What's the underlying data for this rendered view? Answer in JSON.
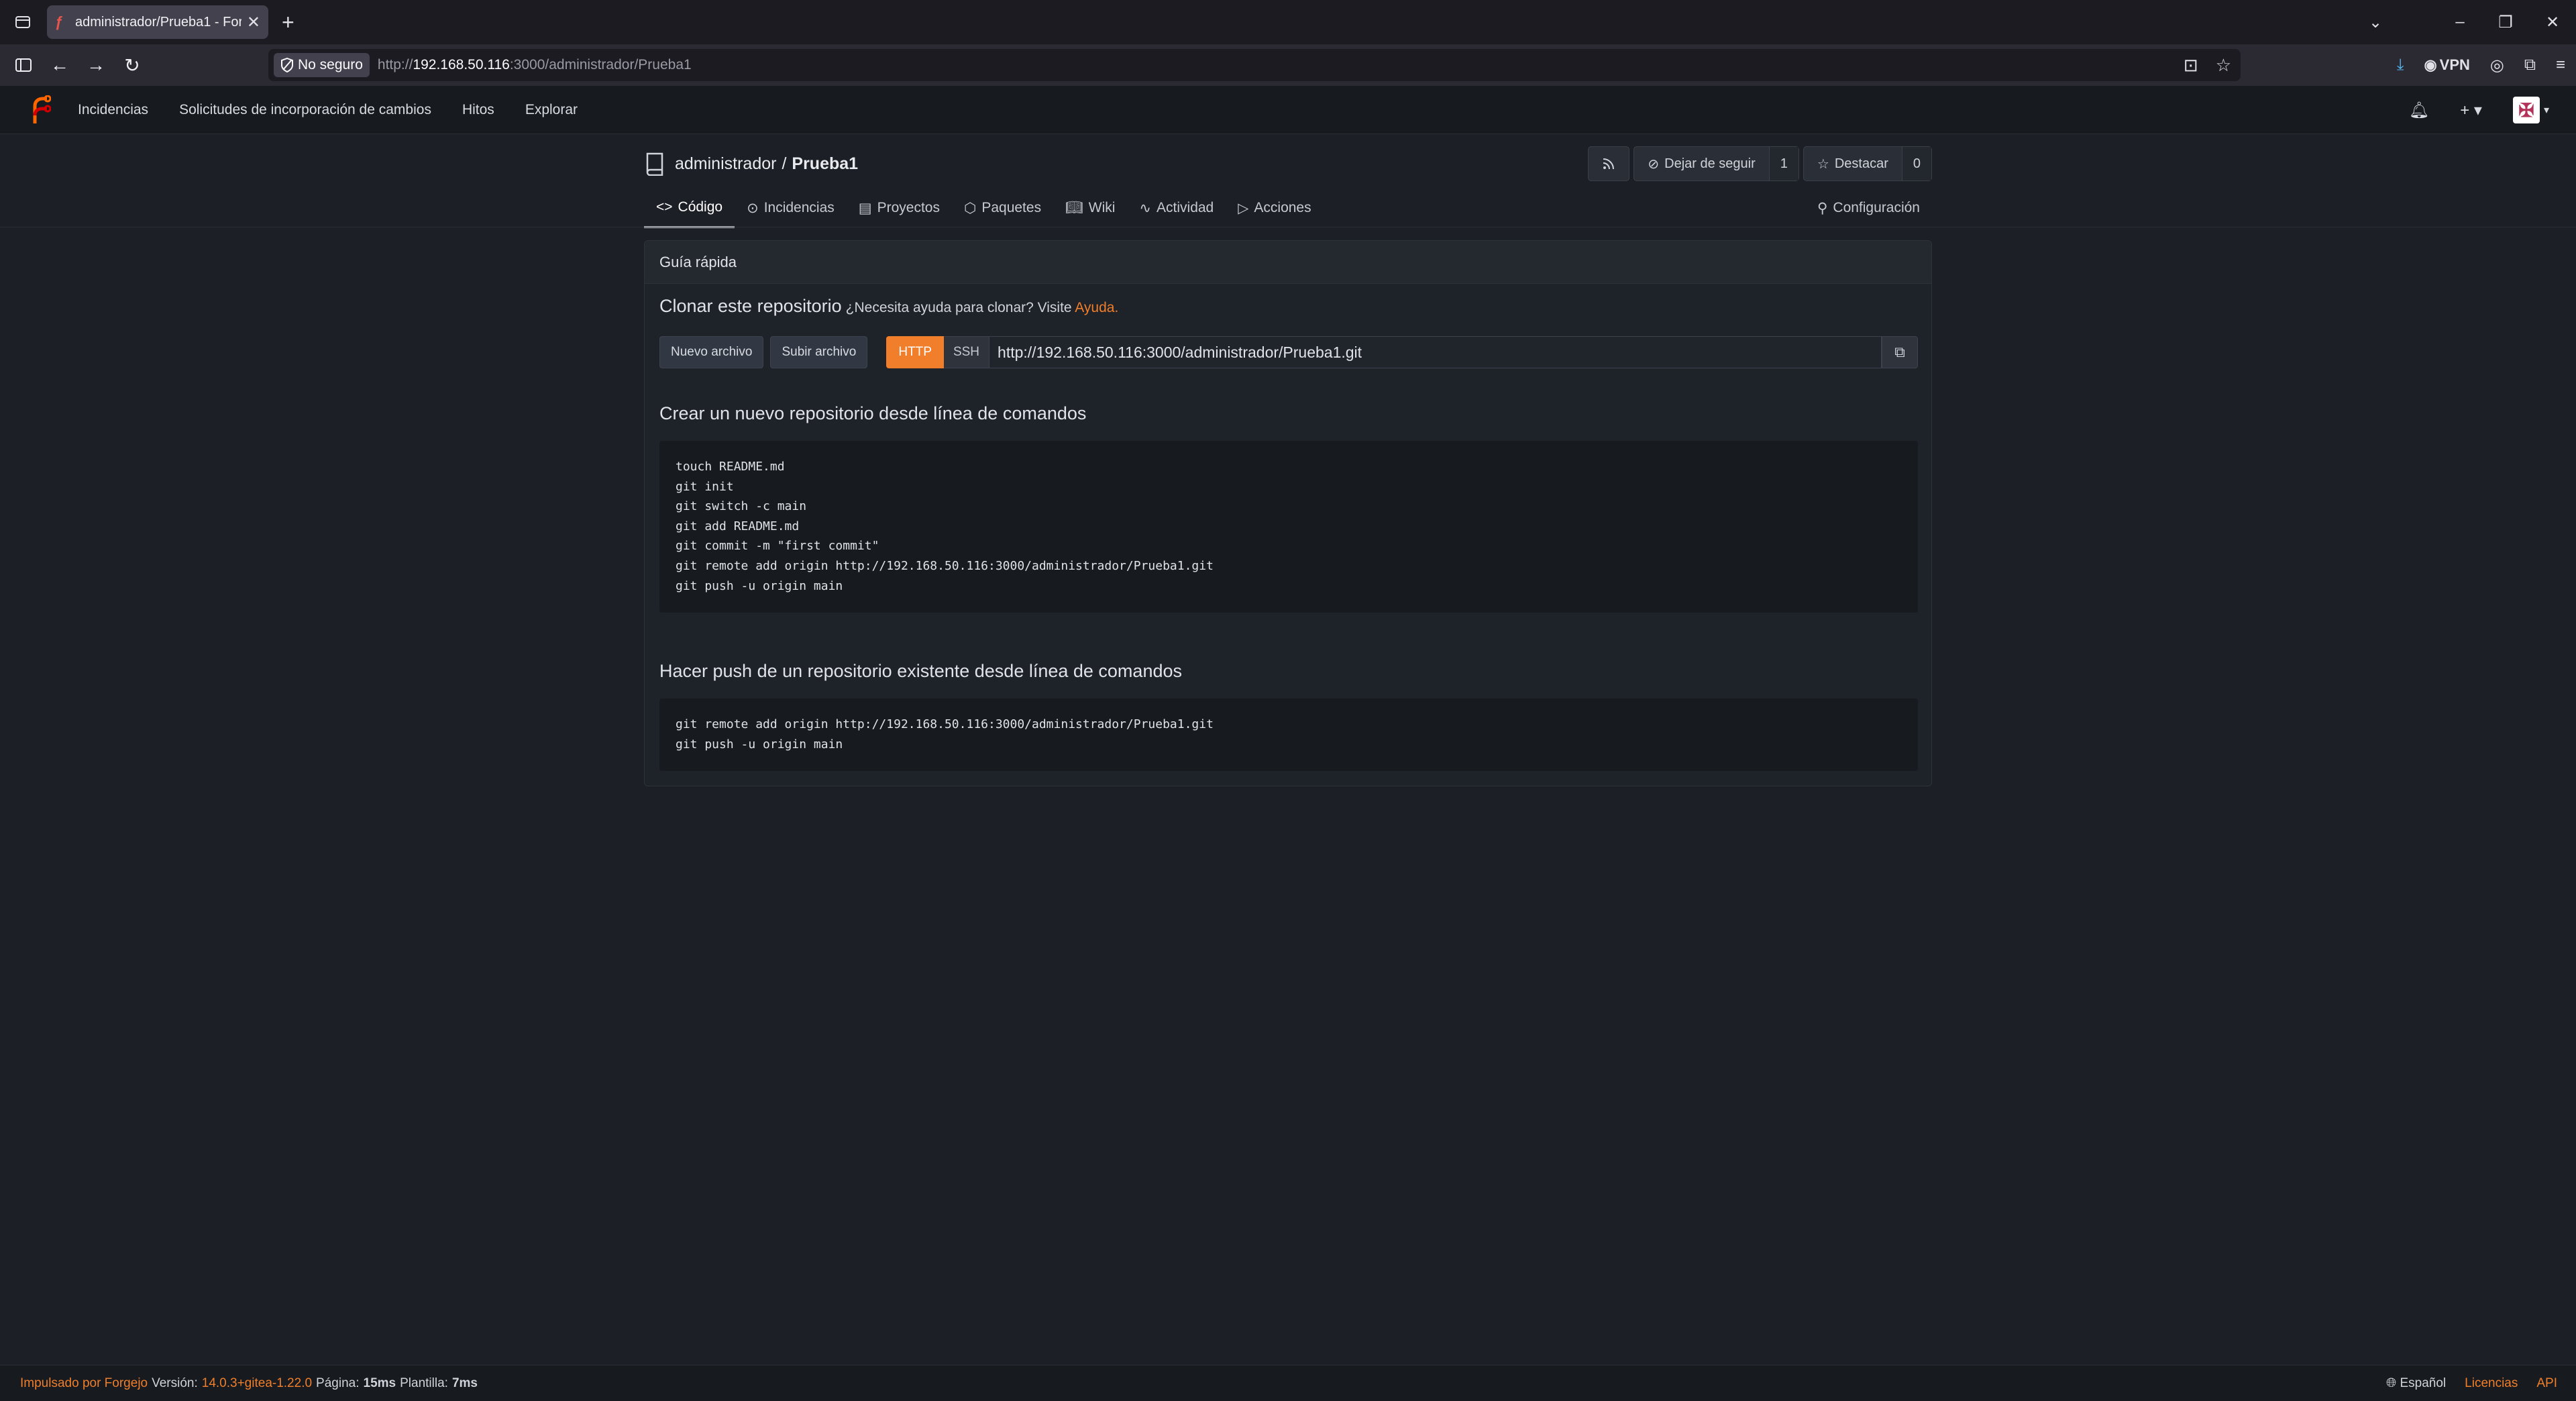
{
  "browser": {
    "tab_title": "administrador/Prueba1 - Forgejo",
    "security_label": "No seguro",
    "url_prefix": "http://",
    "url_host": "192.168.50.116",
    "url_rest": ":3000/administrador/Prueba1",
    "vpn_label": "VPN"
  },
  "forgejo_nav": {
    "items": [
      "Incidencias",
      "Solicitudes de incorporación de cambios",
      "Hitos",
      "Explorar"
    ]
  },
  "repo": {
    "owner": "administrador",
    "separator": "/",
    "name": "Prueba1",
    "unwatch_label": "Dejar de seguir",
    "watch_count": "1",
    "star_label": "Destacar",
    "star_count": "0",
    "tabs": [
      "Código",
      "Incidencias",
      "Proyectos",
      "Paquetes",
      "Wiki",
      "Actividad",
      "Acciones"
    ],
    "settings_label": "Configuración"
  },
  "guide": {
    "header": "Guía rápida",
    "clone_title": "Clonar este repositorio",
    "clone_help_prefix": "¿Necesita ayuda para clonar? Visite ",
    "clone_help_link": "Ayuda",
    "clone_help_suffix": ".",
    "new_file_label": "Nuevo archivo",
    "upload_file_label": "Subir archivo",
    "http_label": "HTTP",
    "ssh_label": "SSH",
    "clone_url": "http://192.168.50.116:3000/administrador/Prueba1.git",
    "new_repo_title": "Crear un nuevo repositorio desde línea de comandos",
    "new_repo_code": [
      "touch README.md",
      "git init",
      "git switch -c main",
      "git add README.md",
      "git commit -m \"first commit\"",
      "git remote add origin http://192.168.50.116:3000/administrador/Prueba1.git",
      "git push -u origin main"
    ],
    "push_title": "Hacer push de un repositorio existente desde línea de comandos",
    "push_code": [
      "git remote add origin http://192.168.50.116:3000/administrador/Prueba1.git",
      "git push -u origin main"
    ]
  },
  "footer": {
    "powered_by": "Impulsado por Forgejo",
    "version_label": "Versión:",
    "version": "14.0.3+gitea-1.22.0",
    "page_label": "Página:",
    "page_time": "15ms",
    "template_label": "Plantilla:",
    "template_time": "7ms",
    "language": "Español",
    "licenses": "Licencias",
    "api": "API"
  },
  "colors": {
    "accent": "#f07e2a",
    "background": "#1c1f25"
  }
}
